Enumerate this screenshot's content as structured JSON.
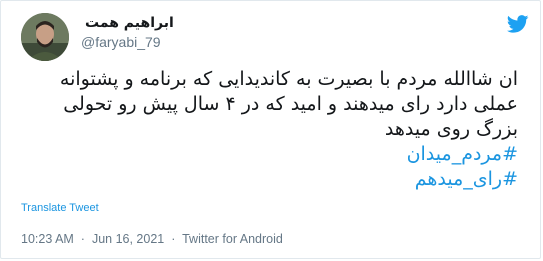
{
  "user": {
    "display_name": "ابراهیم همت",
    "username": "@faryabi_79"
  },
  "tweet": {
    "lines": [
      "ان شاالله مردم با بصیرت به کاندیدایی که برنامه و پشتوانه",
      "عملی دارد رای میدهند و امید که در ۴ سال پیش رو تحولی",
      "بزرگ روی میدهد"
    ],
    "hashtags": [
      "#مردم_میدان",
      "#رای_میدهم"
    ],
    "translate_label": "Translate Tweet",
    "time": "10:23 AM",
    "date": "Jun 16, 2021",
    "source": "Twitter for Android",
    "separator": "·"
  },
  "colors": {
    "link": "#1b95e0",
    "muted": "#657786",
    "text": "#14171a",
    "brand": "#1da1f2"
  }
}
